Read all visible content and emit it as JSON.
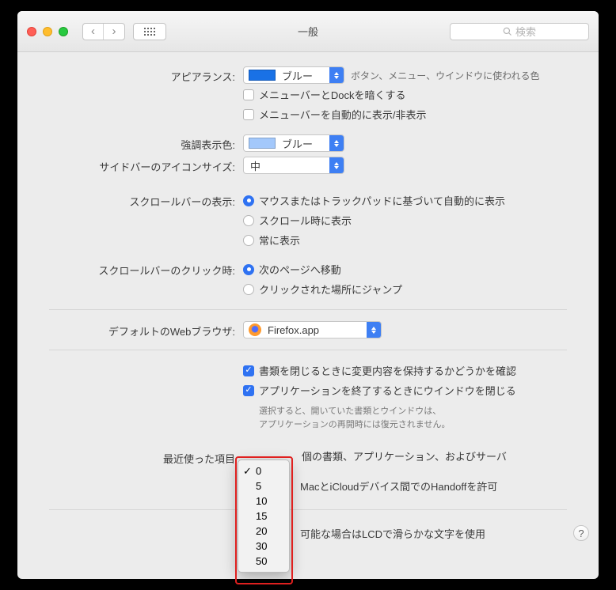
{
  "window": {
    "title": "一般"
  },
  "search": {
    "placeholder": "検索"
  },
  "labels": {
    "appearance": "アピアランス:",
    "highlight": "強調表示色:",
    "sidebar_size": "サイドバーのアイコンサイズ:",
    "scrollbar_show": "スクロールバーの表示:",
    "scrollbar_click": "スクロールバーのクリック時:",
    "default_browser": "デフォルトのWebブラウザ:",
    "recent_items": "最近使った項目"
  },
  "appearance": {
    "value": "ブルー",
    "desc": "ボタン、メニュー、ウインドウに使われる色",
    "swatch": "#1971e6",
    "menubar_dock_dark": "メニューバーとDockを暗くする",
    "menubar_auto": "メニューバーを自動的に表示/非表示"
  },
  "highlight": {
    "value": "ブルー",
    "swatch": "#a3c8fb"
  },
  "sidebar": {
    "value": "中"
  },
  "scrollbar_show": {
    "opt_auto": "マウスまたはトラックパッドに基づいて自動的に表示",
    "opt_scroll": "スクロール時に表示",
    "opt_always": "常に表示"
  },
  "scrollbar_click": {
    "opt_next": "次のページへ移動",
    "opt_jump": "クリックされた場所にジャンプ"
  },
  "browser": {
    "value": "Firefox.app"
  },
  "closing": {
    "confirm_changes": "書類を閉じるときに変更内容を保持するかどうかを確認",
    "close_windows": "アプリケーションを終了するときにウインドウを閉じる",
    "note1": "選択すると、開いていた書類とウインドウは、",
    "note2": "アプリケーションの再開時には復元されません。"
  },
  "recent": {
    "suffix": "個の書類、アプリケーション、およびサーバ",
    "options": [
      "0",
      "5",
      "10",
      "15",
      "20",
      "30",
      "50"
    ],
    "selected": "0"
  },
  "handoff": "MacとiCloudデバイス間でのHandoffを許可",
  "font_smoothing": "可能な場合はLCDで滑らかな文字を使用"
}
